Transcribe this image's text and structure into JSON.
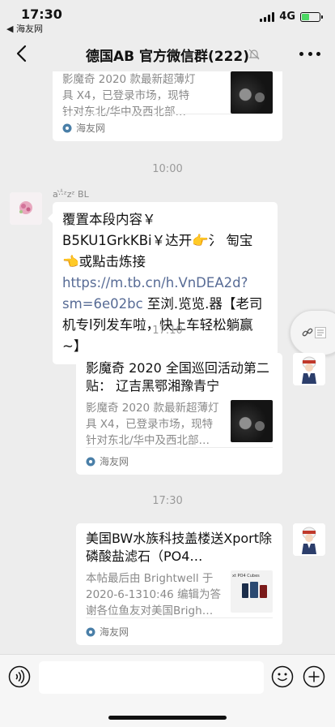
{
  "status_bar": {
    "time": "17:30",
    "back_app": "◀ 海友网",
    "network": "4G"
  },
  "nav": {
    "title": "德国AB 官方微信群(222)"
  },
  "messages": {
    "card1": {
      "desc": "影魔奇 2020 款最新超薄灯具 X4，已登录市场，现特针对东北/华中及西北部…",
      "source": "海友网"
    },
    "time1": "10:00",
    "text_msg": {
      "sender": "a·̀·̂̇ᶻzᶻ BL",
      "text_before_link": "覆置本段内容￥ B5KU1GrkKBi￥达开👉氵 匋宝👈或點击炼接",
      "link": "https://m.tb.cn/h.VnDEA2d?sm=6e02bc",
      "text_after_link": " 至浏.览览.器【老司机专l列发车啦，快上车轻松躺赢~】"
    },
    "time2": "17:10",
    "card2": {
      "title": "影魔奇 2020 全国巡回活动第二贴： 辽吉黑鄂湘豫青宁",
      "desc": "影魔奇 2020 款最新超薄灯具 X4，已登录市场，现特针对东北/华中及西北部…",
      "source": "海友网"
    },
    "time3": "17:30",
    "card3": {
      "title": "美国BW水族科技盖楼送Xport除磷酸盐滤石（PO4…",
      "desc": "本帖最后由 Brightwell 于 2020-6-1310:46 编辑为答谢各位鱼友对美国Brigh…",
      "thumb_caption": "xt PO4 Cubes",
      "source": "海友网"
    }
  },
  "colors": {
    "link": "#576b95",
    "battery": "#4cd964",
    "background": "#ededed"
  }
}
